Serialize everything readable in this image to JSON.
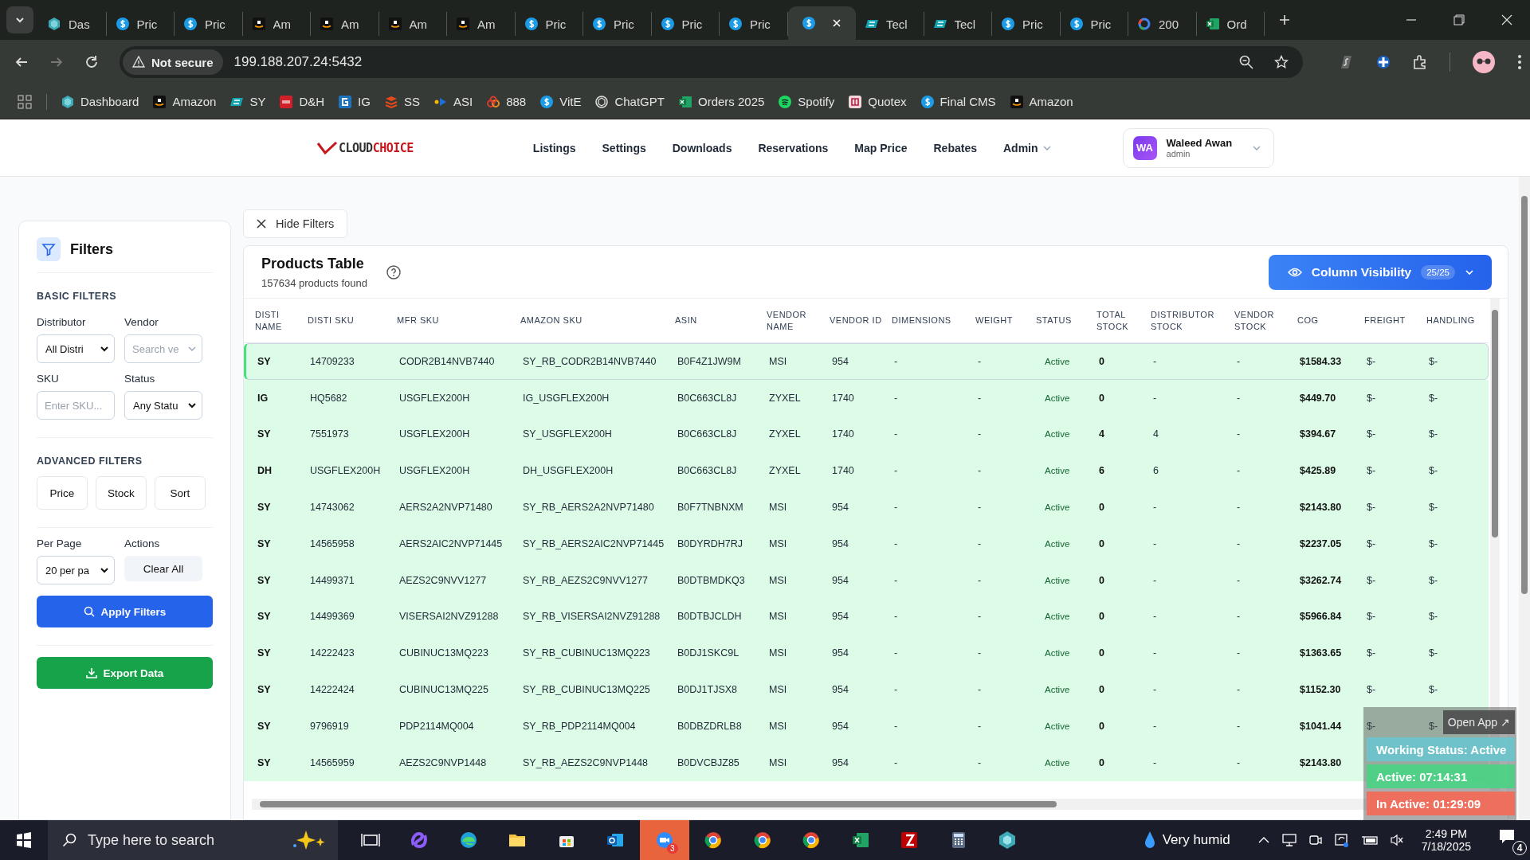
{
  "browser": {
    "tabs": [
      {
        "kind": "hex",
        "label": "Das",
        "selected": false
      },
      {
        "kind": "dollar",
        "label": "Pric",
        "selected": false
      },
      {
        "kind": "dollar",
        "label": "Pric",
        "selected": false
      },
      {
        "kind": "amazon",
        "label": "Am",
        "selected": false
      },
      {
        "kind": "amazon",
        "label": "Am",
        "selected": false
      },
      {
        "kind": "amazon",
        "label": "Am",
        "selected": false
      },
      {
        "kind": "amazon",
        "label": "Am",
        "selected": false
      },
      {
        "kind": "dollar",
        "label": "Pric",
        "selected": false
      },
      {
        "kind": "dollar",
        "label": "Pric",
        "selected": false
      },
      {
        "kind": "dollar",
        "label": "Pric",
        "selected": false
      },
      {
        "kind": "dollar",
        "label": "Pric",
        "selected": false
      },
      {
        "kind": "dollar",
        "selected": true
      },
      {
        "kind": "ec",
        "label": "Tecl",
        "selected": false
      },
      {
        "kind": "ec",
        "label": "Tecl",
        "selected": false
      },
      {
        "kind": "dollar",
        "label": "Pric",
        "selected": false
      },
      {
        "kind": "dollar",
        "label": "Pric",
        "selected": false
      },
      {
        "kind": "google",
        "label": "200",
        "selected": false
      },
      {
        "kind": "excel",
        "label": "Ord",
        "selected": false
      }
    ],
    "security": "Not secure",
    "url": "199.188.207.24:5432",
    "bookmarks": [
      {
        "kind": "hex",
        "label": "Dashboard"
      },
      {
        "kind": "amazon",
        "label": "Amazon"
      },
      {
        "kind": "ec",
        "label": "SY"
      },
      {
        "kind": "dh",
        "label": "D&H"
      },
      {
        "kind": "ig",
        "label": "IG"
      },
      {
        "kind": "ss",
        "label": "SS"
      },
      {
        "kind": "asi",
        "label": "ASI"
      },
      {
        "kind": "rings",
        "label": "888"
      },
      {
        "kind": "dollar",
        "label": "VitE"
      },
      {
        "kind": "knot",
        "label": "ChatGPT"
      },
      {
        "kind": "excel",
        "label": "Orders 2025"
      },
      {
        "kind": "spotify",
        "label": "Spotify"
      },
      {
        "kind": "quotex",
        "label": "Quotex"
      },
      {
        "kind": "dollar",
        "label": "Final CMS"
      },
      {
        "kind": "amazon",
        "label": "Amazon"
      }
    ]
  },
  "header": {
    "logo": {
      "part_1": "CLOUD",
      "part_2": "CHOICE"
    },
    "nav": [
      {
        "label": "Listings",
        "dropdown": false
      },
      {
        "label": "Settings",
        "dropdown": false
      },
      {
        "label": "Downloads",
        "dropdown": false
      },
      {
        "label": "Reservations",
        "dropdown": false
      },
      {
        "label": "Map Price",
        "dropdown": false
      },
      {
        "label": "Rebates",
        "dropdown": false
      },
      {
        "label": "Admin",
        "dropdown": true
      }
    ],
    "user": {
      "initials": "WA",
      "name": "Waleed Awan",
      "role": "admin"
    }
  },
  "filters": {
    "title": "Filters",
    "basic_heading": "BASIC FILTERS",
    "distributor": {
      "label": "Distributor",
      "value": "All Distri"
    },
    "vendor": {
      "label": "Vendor",
      "placeholder": "Search ve"
    },
    "sku": {
      "label": "SKU",
      "placeholder": "Enter SKU..."
    },
    "status": {
      "label": "Status",
      "value": "Any Statu"
    },
    "advanced_heading": "ADVANCED FILTERS",
    "advanced_buttons": [
      "Price",
      "Stock",
      "Sort"
    ],
    "per_page": {
      "label": "Per Page",
      "value": "20 per pa"
    },
    "actions": {
      "label": "Actions",
      "button": "Clear All"
    },
    "apply": "Apply Filters",
    "export": "Export Data"
  },
  "hide_filters": "Hide Filters",
  "table": {
    "title": "Products Table",
    "count": "157634 products found",
    "column_visibility": {
      "label": "Column Visibility",
      "badge": "25/25"
    },
    "columns": [
      {
        "label": "DISTI NAME",
        "kind": "bold"
      },
      {
        "label": "DISTI SKU",
        "kind": "text"
      },
      {
        "label": "MFR SKU",
        "kind": "text"
      },
      {
        "label": "AMAZON SKU",
        "kind": "text"
      },
      {
        "label": "ASIN",
        "kind": "text"
      },
      {
        "label": "VENDOR NAME",
        "kind": "text"
      },
      {
        "label": "VENDOR ID",
        "kind": "text"
      },
      {
        "label": "DIMENSIONS",
        "kind": "text"
      },
      {
        "label": "WEIGHT",
        "kind": "text"
      },
      {
        "label": "STATUS",
        "kind": "status"
      },
      {
        "label": "TOTAL STOCK",
        "kind": "bold"
      },
      {
        "label": "DISTRIBUTOR STOCK",
        "kind": "text"
      },
      {
        "label": "VENDOR STOCK",
        "kind": "text"
      },
      {
        "label": "COG",
        "kind": "bold"
      },
      {
        "label": "FREIGHT",
        "kind": "text"
      },
      {
        "label": "HANDLING",
        "kind": "text"
      }
    ],
    "rows": [
      {
        "selected": true,
        "cells": [
          "SY",
          "14709233",
          "CODR2B14NVB7440",
          "SY_RB_CODR2B14NVB7440",
          "B0F4Z1JW9M",
          "MSI",
          "954",
          "-",
          "-",
          "Active",
          "0",
          "-",
          "-",
          "$1584.33",
          "$-",
          "$-"
        ]
      },
      {
        "selected": false,
        "cells": [
          "IG",
          "HQ5682",
          "USGFLEX200H",
          "IG_USGFLEX200H",
          "B0C663CL8J",
          "ZYXEL",
          "1740",
          "-",
          "-",
          "Active",
          "0",
          "-",
          "-",
          "$449.70",
          "$-",
          "$-"
        ]
      },
      {
        "selected": false,
        "cells": [
          "SY",
          "7551973",
          "USGFLEX200H",
          "SY_USGFLEX200H",
          "B0C663CL8J",
          "ZYXEL",
          "1740",
          "-",
          "-",
          "Active",
          "4",
          "4",
          "-",
          "$394.67",
          "$-",
          "$-"
        ]
      },
      {
        "selected": false,
        "cells": [
          "DH",
          "USGFLEX200H",
          "USGFLEX200H",
          "DH_USGFLEX200H",
          "B0C663CL8J",
          "ZYXEL",
          "1740",
          "-",
          "-",
          "Active",
          "6",
          "6",
          "-",
          "$425.89",
          "$-",
          "$-"
        ]
      },
      {
        "selected": false,
        "cells": [
          "SY",
          "14743062",
          "AERS2A2NVP71480",
          "SY_RB_AERS2A2NVP71480",
          "B0F7TNBNXM",
          "MSI",
          "954",
          "-",
          "-",
          "Active",
          "0",
          "-",
          "-",
          "$2143.80",
          "$-",
          "$-"
        ]
      },
      {
        "selected": false,
        "cells": [
          "SY",
          "14565958",
          "AERS2AIC2NVP71445",
          "SY_RB_AERS2AIC2NVP71445",
          "B0DYRDH7RJ",
          "MSI",
          "954",
          "-",
          "-",
          "Active",
          "0",
          "-",
          "-",
          "$2237.05",
          "$-",
          "$-"
        ]
      },
      {
        "selected": false,
        "cells": [
          "SY",
          "14499371",
          "AEZS2C9NVV1277",
          "SY_RB_AEZS2C9NVV1277",
          "B0DTBMDKQ3",
          "MSI",
          "954",
          "-",
          "-",
          "Active",
          "0",
          "-",
          "-",
          "$3262.74",
          "$-",
          "$-"
        ]
      },
      {
        "selected": false,
        "cells": [
          "SY",
          "14499369",
          "VISERSAI2NVZ91288",
          "SY_RB_VISERSAI2NVZ91288",
          "B0DTBJCLDH",
          "MSI",
          "954",
          "-",
          "-",
          "Active",
          "0",
          "-",
          "-",
          "$5966.84",
          "$-",
          "$-"
        ]
      },
      {
        "selected": false,
        "cells": [
          "SY",
          "14222423",
          "CUBINUC13MQ223",
          "SY_RB_CUBINUC13MQ223",
          "B0DJ1SKC9L",
          "MSI",
          "954",
          "-",
          "-",
          "Active",
          "0",
          "-",
          "-",
          "$1363.65",
          "$-",
          "$-"
        ]
      },
      {
        "selected": false,
        "cells": [
          "SY",
          "14222424",
          "CUBINUC13MQ225",
          "SY_RB_CUBINUC13MQ225",
          "B0DJ1TJSX8",
          "MSI",
          "954",
          "-",
          "-",
          "Active",
          "0",
          "-",
          "-",
          "$1152.30",
          "$-",
          "$-"
        ]
      },
      {
        "selected": false,
        "cells": [
          "SY",
          "9796919",
          "PDP2114MQ004",
          "SY_RB_PDP2114MQ004",
          "B0DBZDRLB8",
          "MSI",
          "954",
          "-",
          "-",
          "Active",
          "0",
          "-",
          "-",
          "$1041.44",
          "$-",
          "$-"
        ]
      },
      {
        "selected": false,
        "cells": [
          "SY",
          "14565959",
          "AEZS2C9NVP1448",
          "SY_RB_AEZS2C9NVP1448",
          "B0DVCBJZ85",
          "MSI",
          "954",
          "-",
          "-",
          "Active",
          "0",
          "-",
          "-",
          "$2143.80"
        ]
      }
    ]
  },
  "tracker": {
    "open_app": "Open App ↗",
    "lines": [
      {
        "kind": "status",
        "text": "Working Status: Active"
      },
      {
        "kind": "active",
        "text": "Active: 07:14:31"
      },
      {
        "kind": "inactive",
        "text": "In Active: 01:29:09"
      }
    ]
  },
  "taskbar": {
    "search_placeholder": "Type here to search",
    "apps": [
      {
        "kind": "taskview"
      },
      {
        "kind": "copilot"
      },
      {
        "kind": "edge"
      },
      {
        "kind": "folder"
      },
      {
        "kind": "store"
      },
      {
        "kind": "outlook"
      },
      {
        "kind": "zoom",
        "badge": "3"
      },
      {
        "kind": "browser"
      },
      {
        "kind": "browser"
      },
      {
        "kind": "browser"
      },
      {
        "kind": "excel"
      },
      {
        "kind": "filezilla"
      },
      {
        "kind": "calculator"
      },
      {
        "kind": "hex"
      }
    ],
    "weather": "Very humid",
    "time": "2:49 PM",
    "date": "7/18/2025",
    "notifications": "4"
  }
}
